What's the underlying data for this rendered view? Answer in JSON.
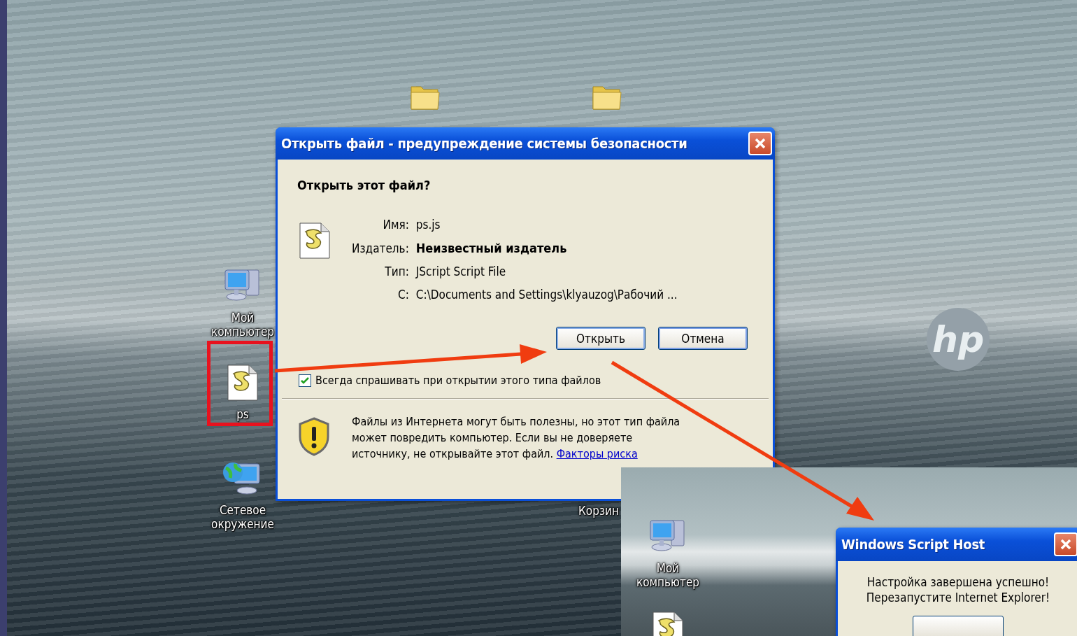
{
  "desktop": {
    "icons": [
      {
        "kind": "computer",
        "label": "Мой компьютер"
      },
      {
        "kind": "script",
        "label": "ps"
      },
      {
        "kind": "network",
        "label": "Сетевое окружение"
      },
      {
        "kind": "none",
        "label": "Корзин"
      }
    ],
    "logo": "hp"
  },
  "dialog": {
    "title": "Открыть файл - предупреждение системы безопасности",
    "question": "Открыть этот файл?",
    "fields": [
      {
        "label": "Имя:",
        "value": "ps.js",
        "bold": false
      },
      {
        "label": "Издатель:",
        "value": "Неизвестный издатель",
        "bold": true
      },
      {
        "label": "Тип:",
        "value": "JScript Script File",
        "bold": false
      },
      {
        "label": "С:",
        "value": "C:\\Documents and Settings\\klyauzog\\Рабочий ...",
        "bold": false
      }
    ],
    "buttons": [
      {
        "label": "Открыть",
        "default": true
      },
      {
        "label": "Отмена",
        "default": false
      }
    ],
    "always_ask": {
      "label": "Всегда спрашивать при открытии этого типа файлов",
      "checked": true
    },
    "warning": "Файлы из Интернета могут быть полезны, но этот тип файла может повредить компьютер. Если вы не доверяете источнику, не открывайте этот файл.",
    "link": "Факторы риска"
  },
  "inset": {
    "icons": [
      {
        "kind": "computer",
        "label": "Мой компьютер"
      },
      {
        "kind": "script"
      }
    ],
    "message_box": {
      "title": "Windows Script Host",
      "lines": [
        "Настройка завершена успешно!",
        "Перезапустите Internet Explorer!"
      ]
    }
  }
}
